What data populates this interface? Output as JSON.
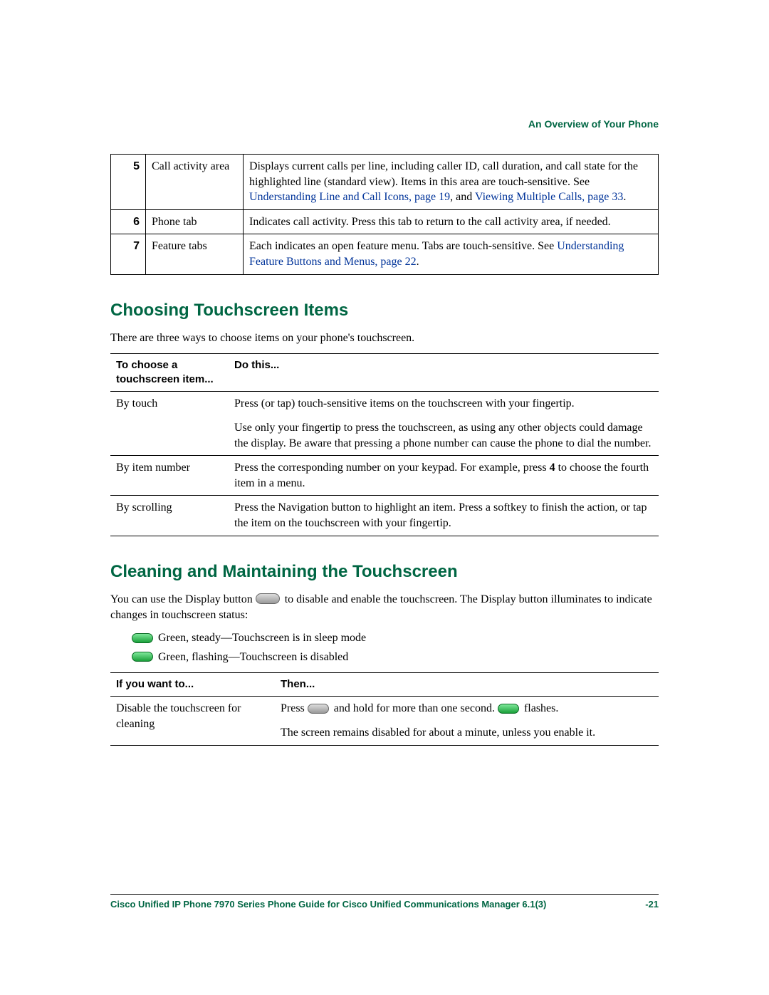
{
  "header": {
    "breadcrumb": "An Overview of Your Phone"
  },
  "table1": {
    "rows": [
      {
        "num": "5",
        "name": "Call activity area",
        "desc_pre": "Displays current calls per line, including caller ID, call duration, and call state for the highlighted line (standard view). Items in this area are touch-sensitive. See ",
        "link1": "Understanding Line and Call Icons, page 19",
        "desc_mid": ", and ",
        "link2": "Viewing Multiple Calls, page 33",
        "desc_post": "."
      },
      {
        "num": "6",
        "name": "Phone tab",
        "desc": "Indicates call activity. Press this tab to return to the call activity area, if needed."
      },
      {
        "num": "7",
        "name": "Feature tabs",
        "desc_pre": "Each indicates an open feature menu. Tabs are touch-sensitive. See ",
        "link1": "Understanding Feature Buttons and Menus, page 22",
        "desc_post": "."
      }
    ]
  },
  "section1": {
    "heading": "Choosing Touchscreen Items",
    "intro": "There are three ways to choose items on your phone's touchscreen.",
    "col1": "To choose a touchscreen item...",
    "col2": "Do this...",
    "rows": [
      {
        "name": "By touch",
        "desc1": "Press (or tap) touch-sensitive items on the touchscreen with your fingertip.",
        "desc2": "Use only your fingertip to press the touchscreen, as using any other objects could damage the display. Be aware that pressing a phone number can cause the phone to dial the number."
      },
      {
        "name": "By item number",
        "desc_pre": "Press the corresponding number on your keypad. For example, press ",
        "desc_bold": "4",
        "desc_post": " to choose the fourth item in a menu."
      },
      {
        "name": "By scrolling",
        "desc": "Press the Navigation button to highlight an item. Press a softkey to finish the action, or tap the item on the touchscreen with your fingertip."
      }
    ]
  },
  "section2": {
    "heading": "Cleaning and Maintaining the Touchscreen",
    "intro_pre": "You can use the Display button ",
    "intro_post": " to disable and enable the touchscreen. The Display button illuminates to indicate changes in touchscreen status:",
    "bullets": [
      "Green, steady—Touchscreen is in sleep mode",
      "Green, flashing—Touchscreen is disabled"
    ],
    "col1": "If you want to...",
    "col2": "Then...",
    "row": {
      "name": "Disable the touchscreen for cleaning",
      "press": "Press ",
      "hold": " and hold for more than one second. ",
      "flashes": " flashes.",
      "line2": "The screen remains disabled for about a minute, unless you enable it."
    }
  },
  "footer": {
    "title": "Cisco Unified IP Phone 7970 Series Phone Guide for Cisco Unified Communications Manager 6.1(3)",
    "page": "-21"
  }
}
